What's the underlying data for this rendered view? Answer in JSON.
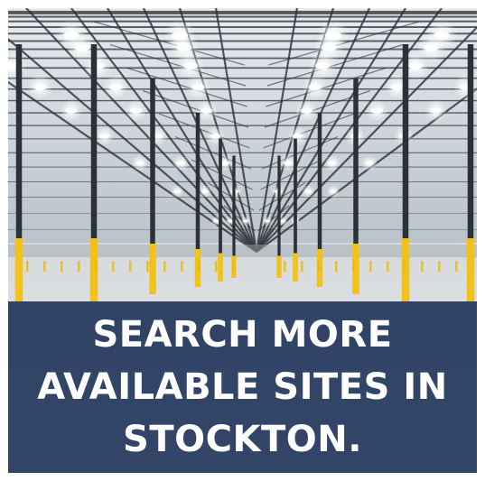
{
  "banner": {
    "text": "SEARCH MORE\nAVAILABLE SITES IN\nSTOCKTON."
  },
  "colors": {
    "banner_bg": "#24385c",
    "text": "#ffffff",
    "column_yellow": "#f2c21a",
    "steel": "#2b3136"
  }
}
